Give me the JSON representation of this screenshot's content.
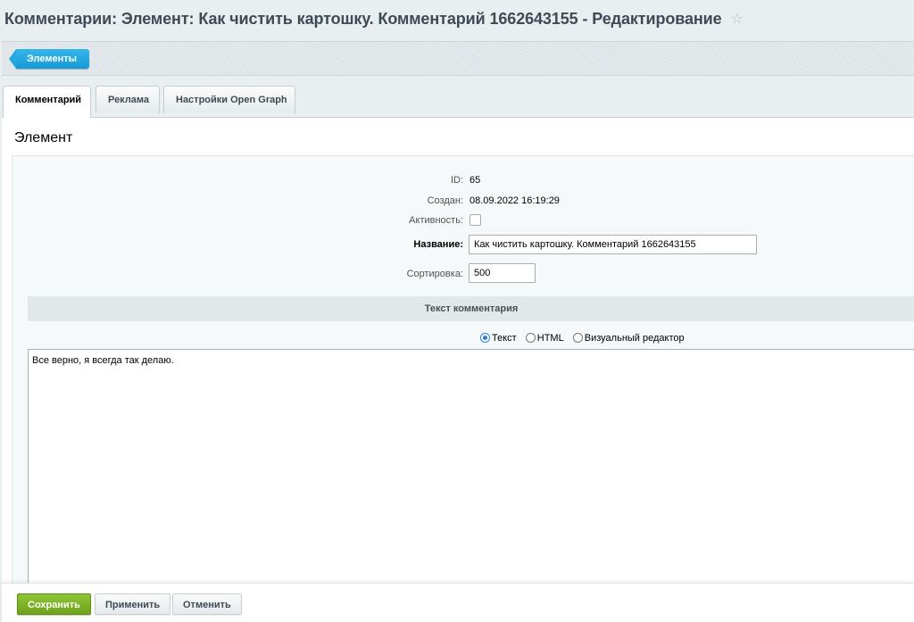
{
  "page": {
    "title": "Комментарии: Элемент: Как чистить картошку. Комментарий 1662643155 - Редактирование",
    "favorite_icon": "star-icon"
  },
  "toolbar": {
    "back_label": "Элементы"
  },
  "tabs": [
    {
      "label": "Комментарий",
      "active": true
    },
    {
      "label": "Реклама",
      "active": false
    },
    {
      "label": "Настройки Open Graph",
      "active": false
    }
  ],
  "section": {
    "title": "Элемент"
  },
  "form": {
    "id_label": "ID:",
    "id_value": "65",
    "created_label": "Создан:",
    "created_value": "08.09.2022 16:19:29",
    "active_label": "Активность:",
    "active_checked": false,
    "name_label": "Название:",
    "name_value": "Как чистить картошку. Комментарий 1662643155",
    "sort_label": "Сортировка:",
    "sort_value": "500"
  },
  "comment": {
    "heading": "Текст комментария",
    "format_options": [
      {
        "label": "Текст",
        "checked": true
      },
      {
        "label": "HTML",
        "checked": false
      },
      {
        "label": "Визуальный редактор",
        "checked": false
      }
    ],
    "text": "Все верно, я всегда так делаю."
  },
  "footer": {
    "save_label": "Сохранить",
    "apply_label": "Применить",
    "cancel_label": "Отменить"
  },
  "colors": {
    "primary_button": "#78ad25",
    "back_button": "#1da5e0",
    "toolbar_bg": "#dde3e6",
    "heading_bar_bg": "#e0e8ea"
  }
}
